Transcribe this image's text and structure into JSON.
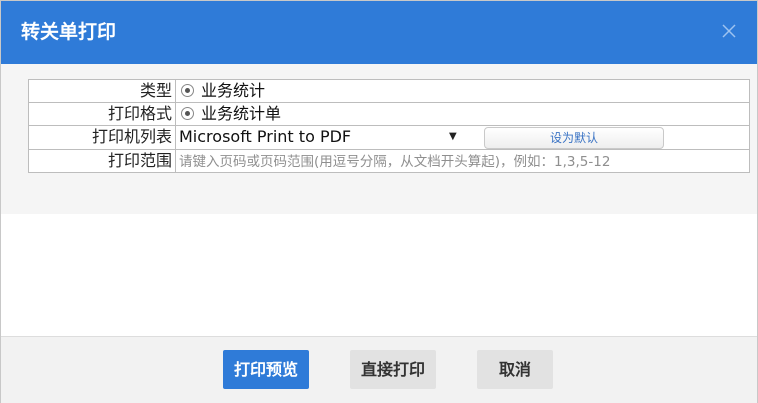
{
  "dialog": {
    "title": "转关单打印"
  },
  "form": {
    "type_label": "类型",
    "type_value": "业务统计",
    "format_label": "打印格式",
    "format_value": "业务统计单",
    "printer_label": "打印机列表",
    "printer_value": "Microsoft Print to PDF",
    "set_default_label": "设为默认",
    "range_label": "打印范围",
    "range_placeholder": "请键入页码或页码范围(用逗号分隔，从文档开头算起)，例如：1,3,5-12",
    "range_value": ""
  },
  "footer": {
    "preview_label": "打印预览",
    "direct_print_label": "直接打印",
    "cancel_label": "取消"
  },
  "colors": {
    "accent": "#2f7bd8"
  }
}
